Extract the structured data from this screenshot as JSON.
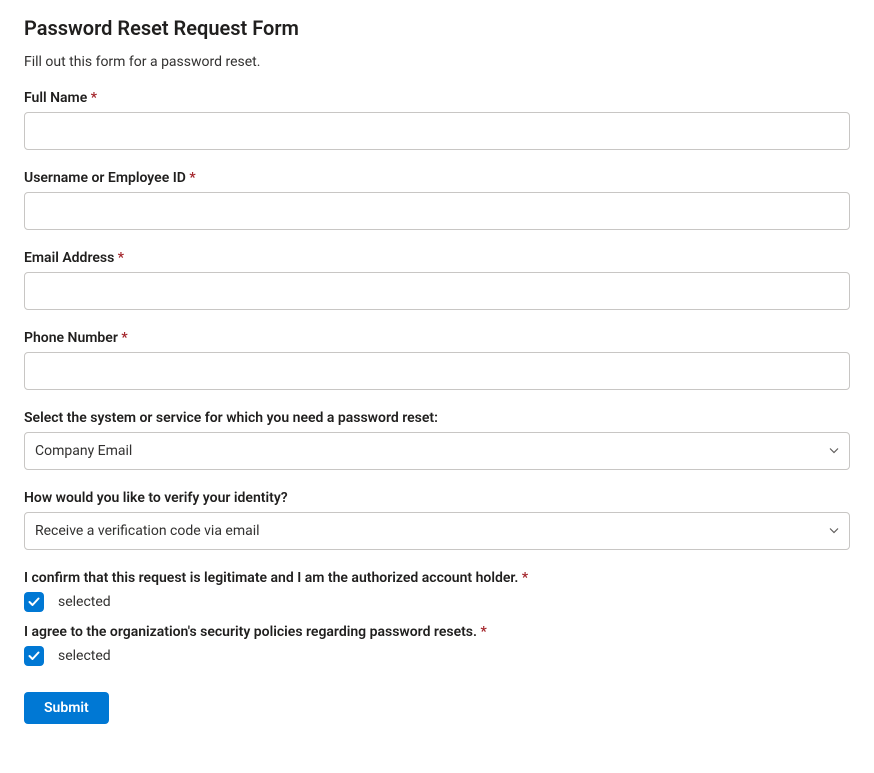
{
  "title": "Password Reset Request Form",
  "subtitle": "Fill out this form for a password reset.",
  "fields": {
    "full_name": {
      "label": "Full Name",
      "required": "*",
      "value": ""
    },
    "username": {
      "label": "Username or Employee ID",
      "required": "*",
      "value": ""
    },
    "email": {
      "label": "Email Address",
      "required": "*",
      "value": ""
    },
    "phone": {
      "label": "Phone Number",
      "required": "*",
      "value": ""
    },
    "system": {
      "label": "Select the system or service for which you need a password reset:",
      "selected": "Company Email"
    },
    "verify": {
      "label": "How would you like to verify your identity?",
      "selected": "Receive a verification code via email"
    },
    "confirm": {
      "label": "I confirm that this request is legitimate and I am the authorized account holder.",
      "required": "*",
      "state": "selected"
    },
    "agree": {
      "label": "I agree to the organization's security policies regarding password resets.",
      "required": "*",
      "state": "selected"
    }
  },
  "submit_label": "Submit"
}
